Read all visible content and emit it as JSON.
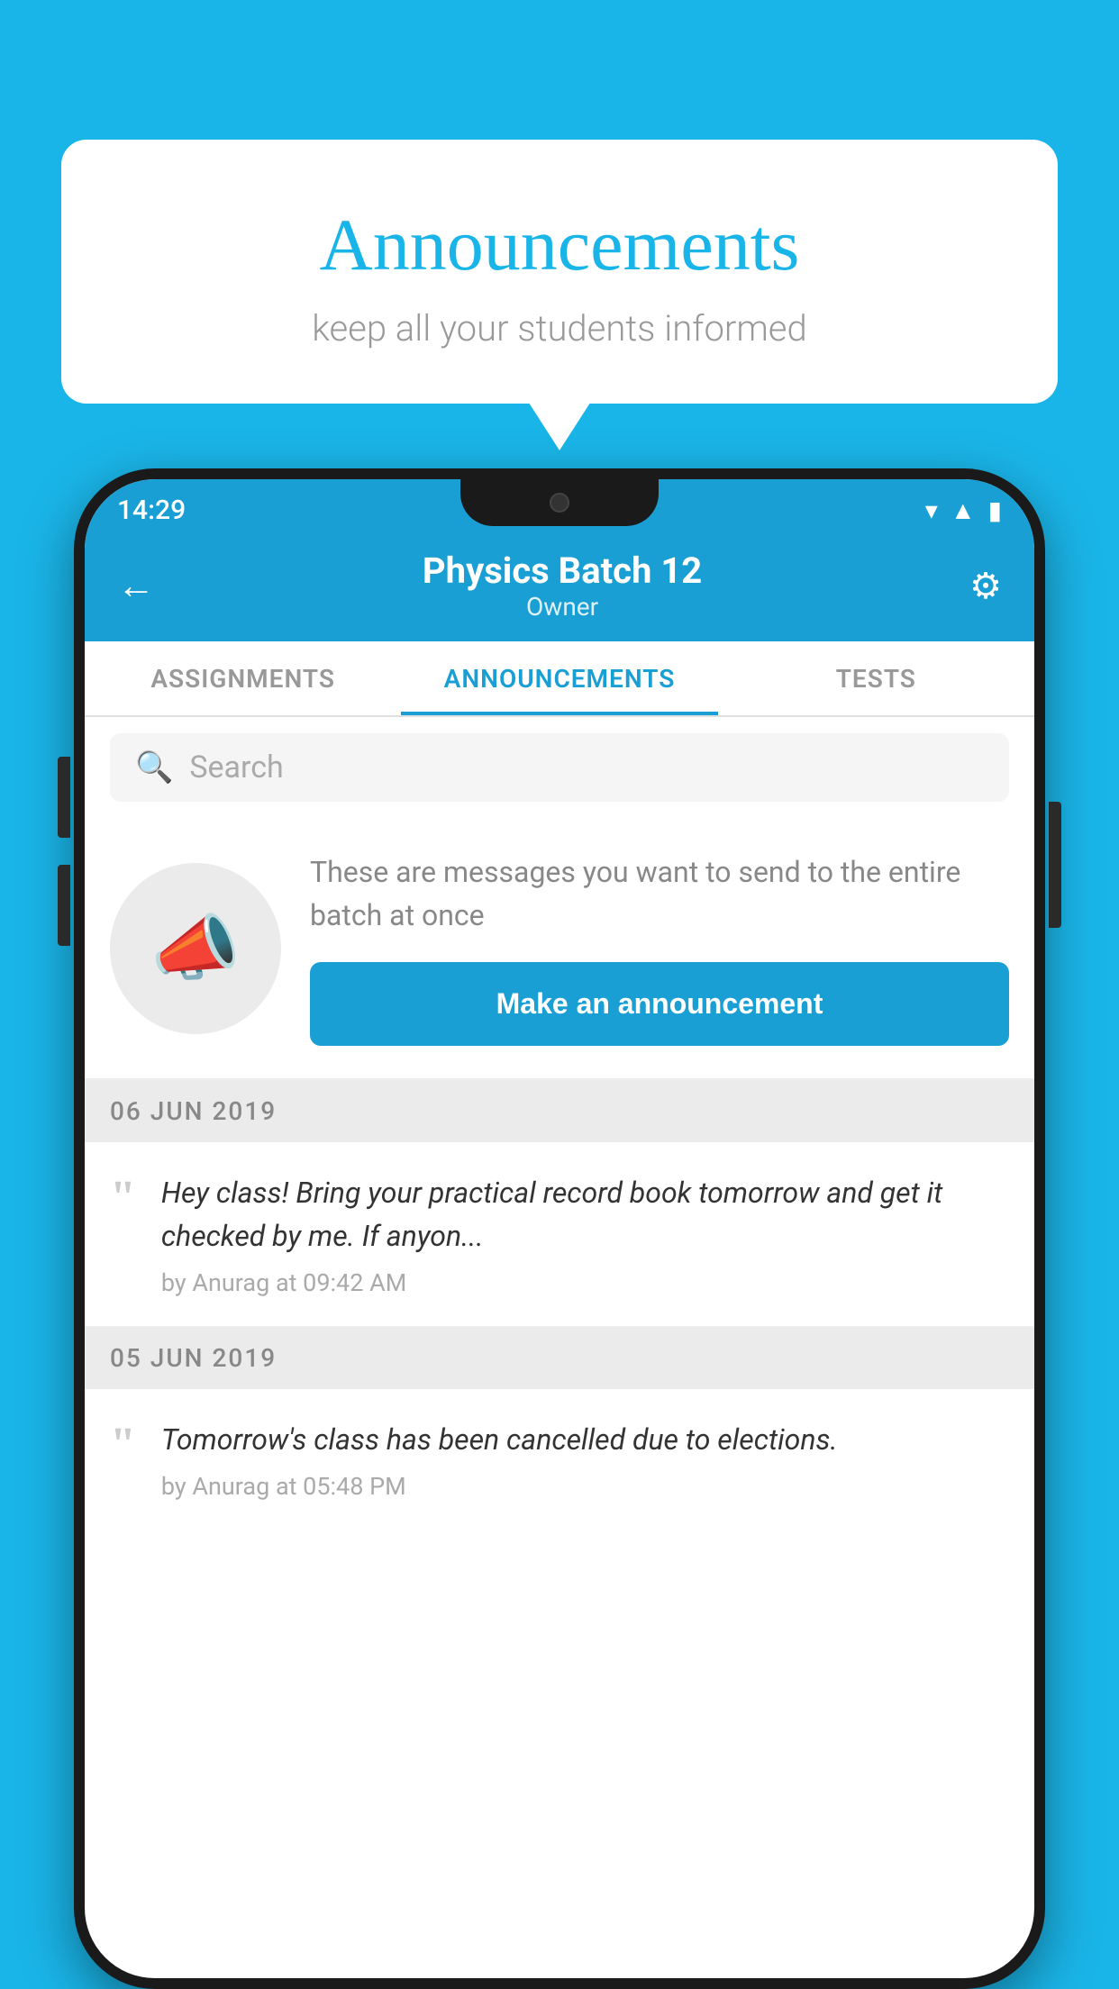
{
  "background": {
    "color": "#1ab5e8"
  },
  "speech_bubble": {
    "title": "Announcements",
    "subtitle": "keep all your students informed"
  },
  "phone": {
    "status_bar": {
      "time": "14:29",
      "icons": [
        "wifi",
        "signal",
        "battery"
      ]
    },
    "header": {
      "title": "Physics Batch 12",
      "subtitle": "Owner",
      "back_label": "←",
      "settings_label": "⚙"
    },
    "tabs": [
      {
        "label": "ASSIGNMENTS",
        "active": false
      },
      {
        "label": "ANNOUNCEMENTS",
        "active": true
      },
      {
        "label": "TESTS",
        "active": false
      }
    ],
    "search": {
      "placeholder": "Search"
    },
    "announcement_prompt": {
      "description": "These are messages you want to send to the entire batch at once",
      "button_label": "Make an announcement"
    },
    "announcements": [
      {
        "date": "06  JUN  2019",
        "text": "Hey class! Bring your practical record book tomorrow and get it checked by me. If anyon...",
        "meta": "by Anurag at 09:42 AM"
      },
      {
        "date": "05  JUN  2019",
        "text": "Tomorrow's class has been cancelled due to elections.",
        "meta": "by Anurag at 05:48 PM"
      }
    ]
  }
}
